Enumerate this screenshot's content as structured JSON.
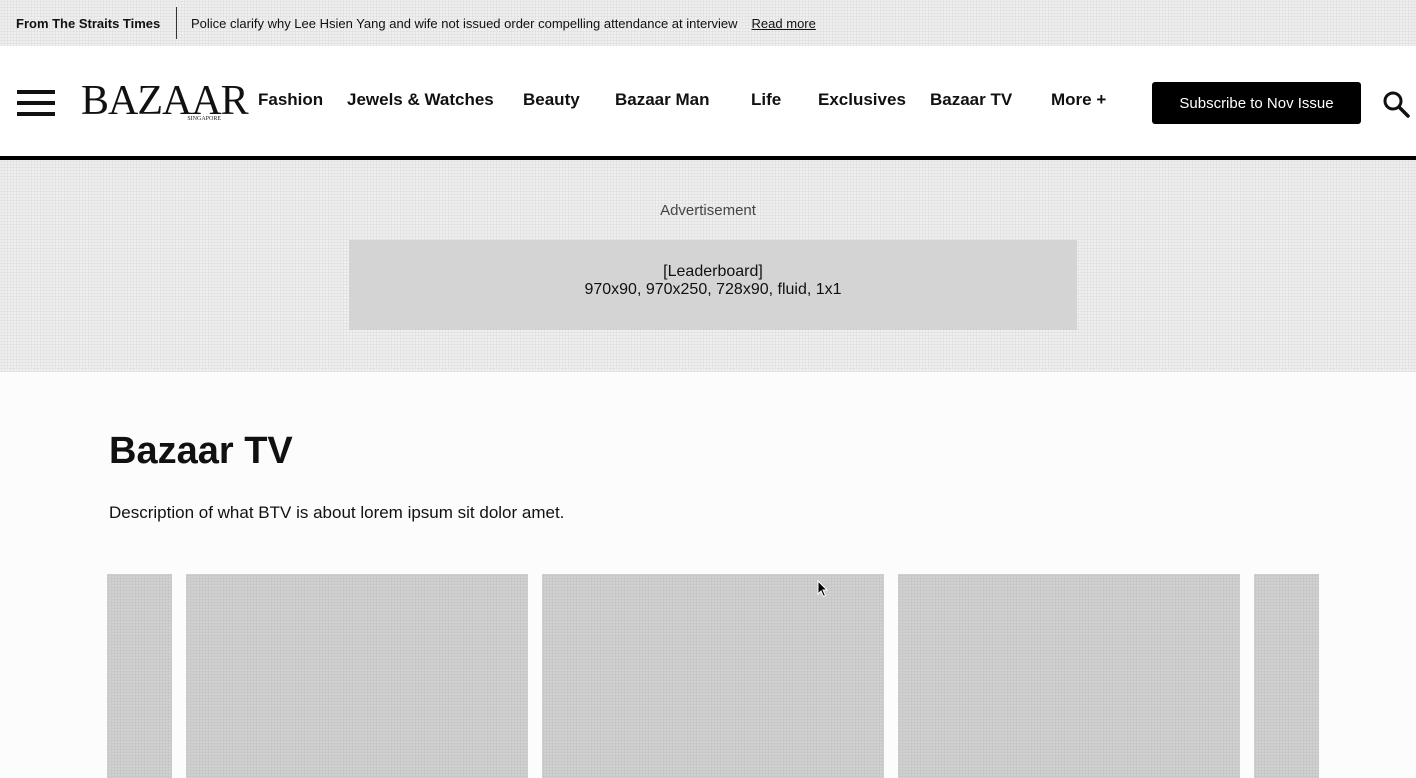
{
  "ticker": {
    "source": "From The Straits Times",
    "headline": "Police clarify why Lee Hsien Yang and wife not issued order compelling attendance at interview",
    "read_more": "Read more"
  },
  "header": {
    "logo": "BAZAAR",
    "logo_sub": "SINGAPORE",
    "nav": [
      {
        "label": "Fashion"
      },
      {
        "label": "Jewels & Watches"
      },
      {
        "label": "Beauty"
      },
      {
        "label": "Bazaar Man"
      },
      {
        "label": "Life"
      },
      {
        "label": "Exclusives"
      },
      {
        "label": "Bazaar TV"
      },
      {
        "label": "More +"
      }
    ],
    "subscribe_label": "Subscribe to Nov Issue",
    "icons": {
      "menu": "hamburger-menu-icon",
      "search": "search-icon"
    }
  },
  "ad": {
    "label": "Advertisement",
    "slot_name": "[Leaderboard]",
    "slot_sizes": "970x90, 970x250, 728x90, fluid, 1x1"
  },
  "main": {
    "title": "Bazaar TV",
    "description": "Description of what BTV is about lorem ipsum sit dolor amet."
  },
  "colors": {
    "brand_black": "#000000",
    "ad_placeholder": "#d4d4d4",
    "card_placeholder": "#d0d0d0"
  }
}
